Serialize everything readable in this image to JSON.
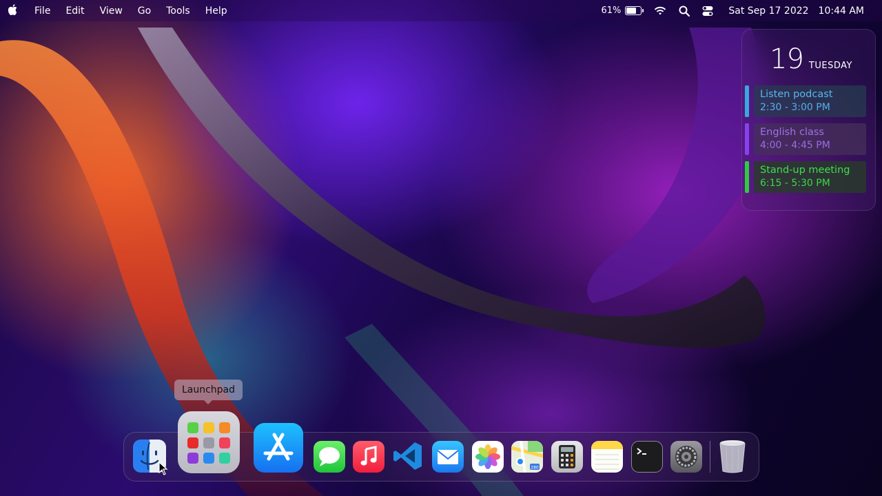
{
  "menubar": {
    "apple_icon": "apple-icon",
    "menus": [
      "File",
      "Edit",
      "View",
      "Go",
      "Tools",
      "Help"
    ],
    "battery_percent": "61%",
    "battery_level": 0.61,
    "date": "Sat Sep 17 2022",
    "time": "10:44 AM"
  },
  "calendar_widget": {
    "day": "19",
    "weekday": "TUESDAY",
    "events": [
      {
        "title": "Listen podcast",
        "time": "2:30 - 3:00 PM",
        "color": "#3aa8e0",
        "bg": "rgba(40,60,80,.75)",
        "text": "#55b8f0"
      },
      {
        "title": "English class",
        "time": "4:00 - 4:45 PM",
        "color": "#8a3ff0",
        "bg": "rgba(70,50,90,.75)",
        "text": "#a070e8"
      },
      {
        "title": "Stand-up meeting",
        "time": "6:15 - 5:30 PM",
        "color": "#2ecc40",
        "bg": "rgba(40,60,40,.8)",
        "text": "#3be04a"
      }
    ]
  },
  "dock": {
    "tooltip": "Launchpad",
    "apps": [
      "Finder",
      "Launchpad",
      "App Store",
      "Messages",
      "Music",
      "Visual Studio Code",
      "Mail",
      "Photos",
      "Maps",
      "Calculator",
      "Notes",
      "Terminal",
      "System Preferences",
      "Trash"
    ],
    "maps_badge": "280"
  }
}
